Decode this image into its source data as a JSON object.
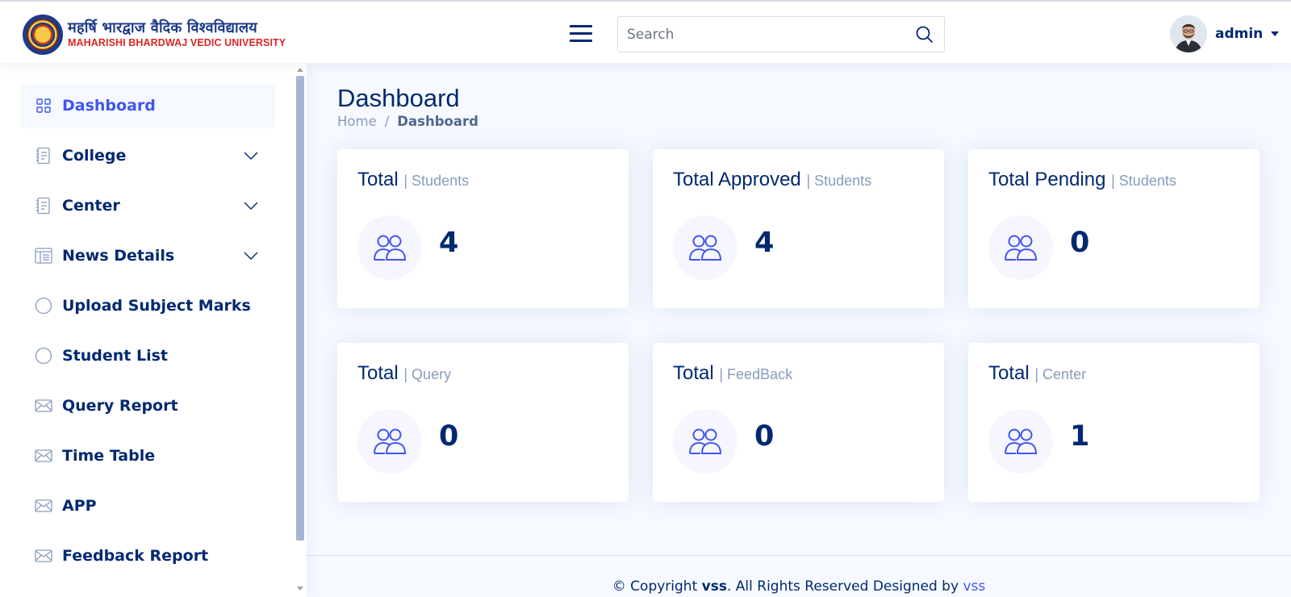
{
  "header": {
    "logo": {
      "hindi": "महर्षि भारद्वाज वैदिक विश्वविद्यालय",
      "english": "MAHARISHI BHARDWAJ VEDIC UNIVERSITY"
    },
    "menu_icon": "hamburger-icon",
    "search": {
      "placeholder": "Search",
      "value": "",
      "icon": "search-icon"
    },
    "user": {
      "name": "admin",
      "avatar": "avatar"
    }
  },
  "sidebar": {
    "items": [
      {
        "label": "Dashboard",
        "icon": "grid-icon",
        "active": true,
        "expandable": false
      },
      {
        "label": "College",
        "icon": "journal-icon",
        "active": false,
        "expandable": true
      },
      {
        "label": "Center",
        "icon": "journal-icon",
        "active": false,
        "expandable": true
      },
      {
        "label": "News Details",
        "icon": "layout-text-icon",
        "active": false,
        "expandable": true
      },
      {
        "label": "Upload Subject Marks",
        "icon": "circle-icon",
        "active": false,
        "expandable": false
      },
      {
        "label": "Student List",
        "icon": "circle-icon",
        "active": false,
        "expandable": false
      },
      {
        "label": "Query Report",
        "icon": "envelope-icon",
        "active": false,
        "expandable": false
      },
      {
        "label": "Time Table",
        "icon": "envelope-icon",
        "active": false,
        "expandable": false
      },
      {
        "label": "APP",
        "icon": "envelope-icon",
        "active": false,
        "expandable": false
      },
      {
        "label": "Feedback Report",
        "icon": "envelope-icon",
        "active": false,
        "expandable": false
      }
    ]
  },
  "main": {
    "title": "Dashboard",
    "breadcrumb": {
      "home": "Home",
      "separator": "/",
      "current": "Dashboard"
    },
    "cards": [
      {
        "title": "Total",
        "subtitle": "| Students",
        "value": "4",
        "icon": "people-icon"
      },
      {
        "title": "Total Approved",
        "subtitle": "| Students",
        "value": "4",
        "icon": "people-icon"
      },
      {
        "title": "Total Pending",
        "subtitle": "| Students",
        "value": "0",
        "icon": "people-icon"
      },
      {
        "title": "Total",
        "subtitle": "| Query",
        "value": "0",
        "icon": "people-icon"
      },
      {
        "title": "Total",
        "subtitle": "| FeedBack",
        "value": "0",
        "icon": "people-icon"
      },
      {
        "title": "Total",
        "subtitle": "| Center",
        "value": "1",
        "icon": "people-icon"
      }
    ]
  },
  "footer": {
    "prefix": "© Copyright ",
    "brand": "vss",
    "middle": ". All Rights Reserved Designed by ",
    "link": "vss"
  },
  "colors": {
    "primary": "#012970",
    "accent": "#4154f1",
    "muted": "#899bbd",
    "background": "#f6f9ff",
    "logo_red": "#dc2626",
    "logo_blue": "#1e3a8a"
  }
}
